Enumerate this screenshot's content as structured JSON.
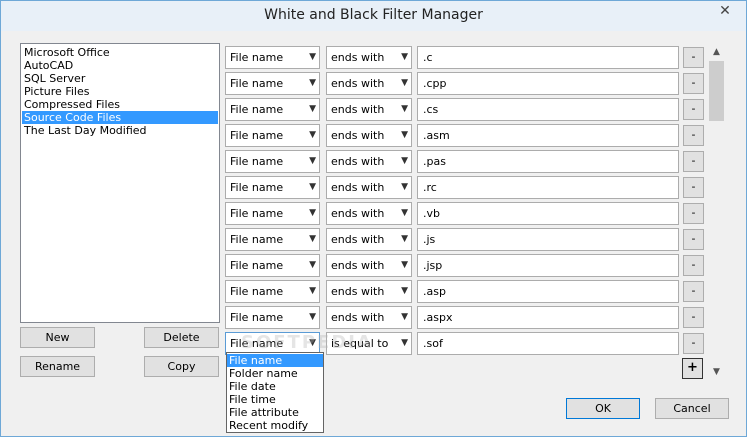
{
  "window": {
    "title": "White and Black Filter Manager",
    "close_glyph": "✕"
  },
  "filter_list": {
    "items": [
      {
        "label": "Microsoft Office",
        "selected": false
      },
      {
        "label": "AutoCAD",
        "selected": false
      },
      {
        "label": "SQL Server",
        "selected": false
      },
      {
        "label": "Picture Files",
        "selected": false
      },
      {
        "label": "Compressed Files",
        "selected": false
      },
      {
        "label": "Source Code Files",
        "selected": true
      },
      {
        "label": "The Last Day Modified",
        "selected": false
      }
    ]
  },
  "list_buttons": {
    "new": "New",
    "delete": "Delete",
    "rename": "Rename",
    "copy": "Copy"
  },
  "rules": [
    {
      "field": "File name",
      "op": "ends with",
      "value": ".c"
    },
    {
      "field": "File name",
      "op": "ends with",
      "value": ".cpp"
    },
    {
      "field": "File name",
      "op": "ends with",
      "value": ".cs"
    },
    {
      "field": "File name",
      "op": "ends with",
      "value": ".asm"
    },
    {
      "field": "File name",
      "op": "ends with",
      "value": ".pas"
    },
    {
      "field": "File name",
      "op": "ends with",
      "value": ".rc"
    },
    {
      "field": "File name",
      "op": "ends with",
      "value": ".vb"
    },
    {
      "field": "File name",
      "op": "ends with",
      "value": ".js"
    },
    {
      "field": "File name",
      "op": "ends with",
      "value": ".jsp"
    },
    {
      "field": "File name",
      "op": "ends with",
      "value": ".asp"
    },
    {
      "field": "File name",
      "op": "ends with",
      "value": ".aspx"
    },
    {
      "field": "File name",
      "op": "is equal to",
      "value": ".sof"
    }
  ],
  "remove_label": "-",
  "add_label": "+",
  "dropdown": {
    "options": [
      {
        "label": "File name",
        "selected": true
      },
      {
        "label": "Folder name",
        "selected": false
      },
      {
        "label": "File date",
        "selected": false
      },
      {
        "label": "File time",
        "selected": false
      },
      {
        "label": "File attribute",
        "selected": false
      },
      {
        "label": "Recent modify",
        "selected": false
      }
    ]
  },
  "watermark": "SOFTPEDIA",
  "dialog_buttons": {
    "ok": "OK",
    "cancel": "Cancel"
  },
  "icons": {
    "combo_arrow": "chevron-down-icon",
    "scroll_up": "chevron-up-icon",
    "scroll_down": "chevron-down-icon"
  }
}
